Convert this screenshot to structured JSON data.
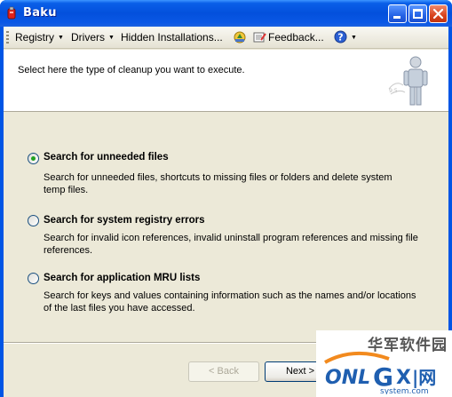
{
  "window": {
    "title": "Baku",
    "colors": {
      "titlebar": "#0350dc",
      "client": "#ece9d8",
      "radio_dot": "#21a121"
    }
  },
  "menu": {
    "items": [
      {
        "label": "Registry",
        "dropdown": true
      },
      {
        "label": "Drivers",
        "dropdown": true
      },
      {
        "label": "Hidden Installations..."
      },
      {
        "label": "Feedback...",
        "icon": "feedback-icon"
      },
      {
        "label": "",
        "icon": "help-icon",
        "dropdown": true
      }
    ],
    "update_icon": "update-icon"
  },
  "header": {
    "instruction": "Select here the type of cleanup you want to execute.",
    "graphic": "person-icon"
  },
  "options": [
    {
      "label": "Search for unneeded files",
      "selected": true,
      "description": "Search for unneeded files, shortcuts to missing files or folders and delete system temp files."
    },
    {
      "label": "Search for system registry errors",
      "selected": false,
      "description": "Search for invalid icon references, invalid uninstall program references and missing file references."
    },
    {
      "label": "Search for application MRU lists",
      "selected": false,
      "description": "Search for keys and values containing information such as the names and/or locations of the last files you have accessed."
    }
  ],
  "buttons": {
    "back": "< Back",
    "next": "Next >"
  },
  "watermark": {
    "cn_text": "华军软件园",
    "brand_left": "ONL",
    "brand_mid": "G",
    "brand_right": "X",
    "brand_end": "|网",
    "subtext": "system.com"
  }
}
